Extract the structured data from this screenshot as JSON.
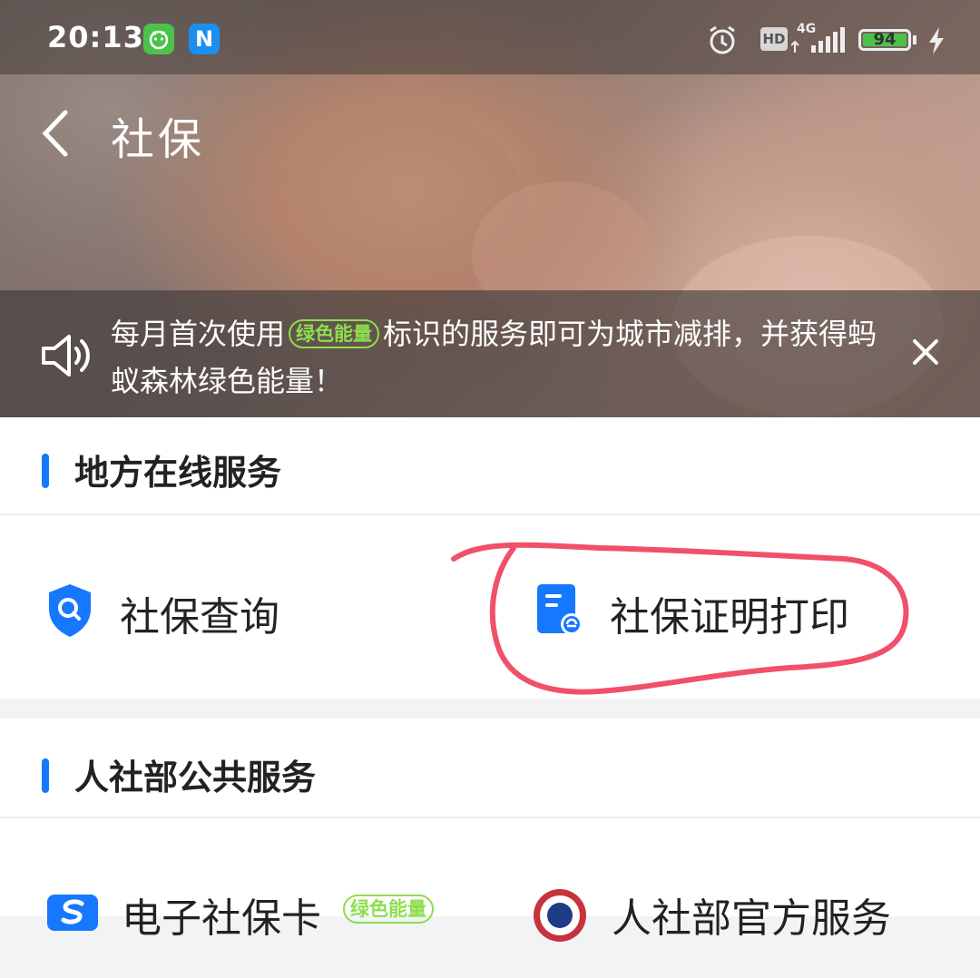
{
  "status_bar": {
    "time": "20:13",
    "app_badge_2": "N",
    "hd": "HD",
    "signal": "4G",
    "battery": "94"
  },
  "nav": {
    "title": "社保"
  },
  "notice": {
    "text_before": "每月首次使用",
    "tag": "绿色能量",
    "text_after": "标识的服务即可为城市减排，并获得蚂蚁森林绿色能量！"
  },
  "local_services": {
    "title": "地方在线服务",
    "items": [
      {
        "label": "社保查询",
        "icon": "shield-search-icon"
      },
      {
        "label": "社保证明打印",
        "icon": "document-print-icon"
      }
    ]
  },
  "public_services": {
    "title": "人社部公共服务",
    "items": [
      {
        "label": "电子社保卡",
        "tag": "绿色能量",
        "icon": "social-security-card-icon"
      },
      {
        "label": "人社部官方服务",
        "icon": "ministry-seal-icon"
      }
    ]
  },
  "colors": {
    "accent": "#1677ff",
    "energy_green": "#8dde4f",
    "annotation_red": "#f0506a"
  }
}
